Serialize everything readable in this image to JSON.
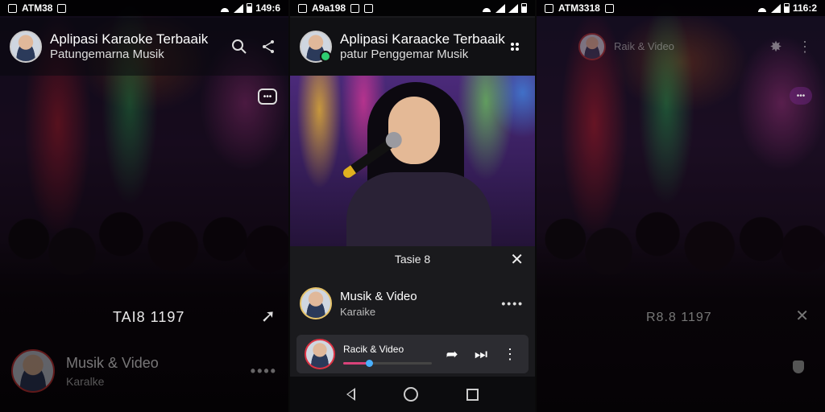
{
  "panel1": {
    "status": {
      "time": "ATM38",
      "right_text": "149:6"
    },
    "appbar": {
      "title": "Aplipasi Karaoke Terbaaik",
      "subtitle": "Patungemarna Musik"
    },
    "overlay": {
      "text": "TAI8 1197"
    },
    "row": {
      "title": "Musik & Video",
      "subtitle": "Karalke",
      "more": "••••"
    }
  },
  "panel2": {
    "status": {
      "time": "A9a198"
    },
    "appbar": {
      "title": "Aplipasi Karaacke Terbaaik",
      "subtitle": "patur Penggemar Musik"
    },
    "sheet": {
      "title": "Tasie 8",
      "row": {
        "title": "Musik & Video",
        "subtitle": "Karaike",
        "more": "••••"
      }
    },
    "mini_player": {
      "title": "Racik & Video",
      "progress_percent": 30
    }
  },
  "panel3": {
    "status": {
      "time": "ATM3318",
      "right_text": "116:2"
    },
    "appbar": {
      "title": "Raik & Video"
    },
    "overlay": {
      "text": "R8.8 1197"
    }
  },
  "icons": [
    "search-icon",
    "share-icon",
    "close-icon",
    "more-vertical-icon",
    "play-next-icon",
    "back-icon",
    "home-icon",
    "recents-icon"
  ]
}
